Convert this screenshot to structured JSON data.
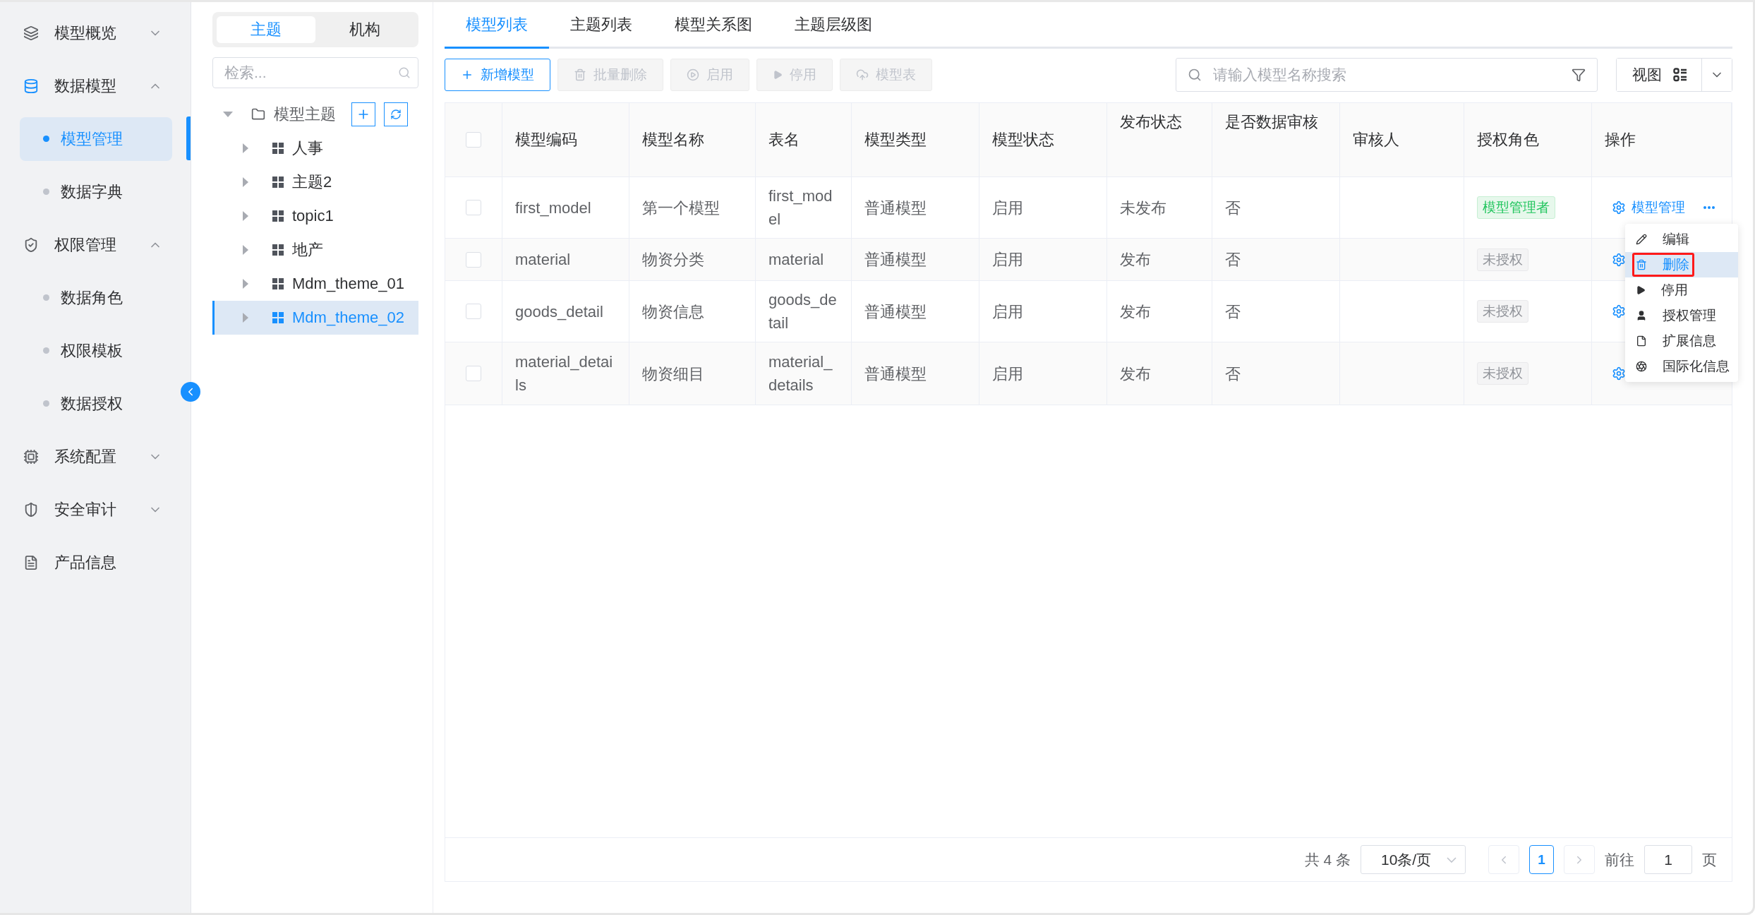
{
  "sidebar": {
    "groups": [
      {
        "label": "模型概览",
        "expanded": false
      },
      {
        "label": "数据模型",
        "expanded": true,
        "active": true,
        "items": [
          {
            "label": "模型管理",
            "selected": true
          },
          {
            "label": "数据字典",
            "selected": false
          }
        ]
      },
      {
        "label": "权限管理",
        "expanded": true,
        "active": false,
        "items": [
          {
            "label": "数据角色",
            "selected": false
          },
          {
            "label": "权限模板",
            "selected": false
          },
          {
            "label": "数据授权",
            "selected": false
          }
        ]
      },
      {
        "label": "系统配置",
        "expanded": false
      },
      {
        "label": "安全审计",
        "expanded": false
      },
      {
        "label": "产品信息",
        "kind": "link"
      }
    ]
  },
  "tree_panel": {
    "segments": [
      {
        "label": "主题",
        "selected": true
      },
      {
        "label": "机构",
        "selected": false
      }
    ],
    "search": {
      "placeholder": "检索..."
    },
    "root": {
      "label": "模型主题",
      "expanded": true,
      "children": [
        {
          "label": "人事",
          "selected": false
        },
        {
          "label": "主题2",
          "selected": false
        },
        {
          "label": "topic1",
          "selected": false
        },
        {
          "label": "地产",
          "selected": false
        },
        {
          "label": "Mdm_theme_01",
          "selected": false
        },
        {
          "label": "Mdm_theme_02",
          "selected": true
        }
      ]
    }
  },
  "tabs": [
    {
      "label": "模型列表",
      "selected": true
    },
    {
      "label": "主题列表",
      "selected": false
    },
    {
      "label": "模型关系图",
      "selected": false
    },
    {
      "label": "主题层级图",
      "selected": false
    }
  ],
  "toolbar": {
    "buttons": [
      {
        "label": "新增模型",
        "disabled": false
      },
      {
        "label": "批量删除",
        "disabled": true
      },
      {
        "label": "启用",
        "disabled": true
      },
      {
        "label": "停用",
        "disabled": true
      },
      {
        "label": "模型表",
        "disabled": true
      }
    ],
    "search": {
      "placeholder": "请输入模型名称搜索"
    },
    "view_button": "视图"
  },
  "table": {
    "header_checked": false,
    "columns": [
      "模型编码",
      "模型名称",
      "表名",
      "模型类型",
      "模型状态",
      "发布状态",
      "是否数据审核",
      "审核人",
      "授权角色",
      "操作"
    ],
    "rows": [
      {
        "checked": false,
        "cells": [
          "first_model",
          "第一个模型",
          "first_model",
          "普通模型",
          "启用",
          "未发布",
          "否"
        ],
        "role": {
          "label": "模型管理者",
          "kind": "granted"
        },
        "action": "模型管理"
      },
      {
        "checked": false,
        "cells": [
          "material",
          "物资分类",
          "material",
          "普通模型",
          "启用",
          "发布",
          "否"
        ],
        "role": {
          "label": "未授权",
          "kind": "none"
        }
      },
      {
        "checked": false,
        "cells": [
          "goods_detail",
          "物资信息",
          "goods_detail",
          "普通模型",
          "启用",
          "发布",
          "否"
        ],
        "role": {
          "label": "未授权",
          "kind": "none"
        }
      },
      {
        "checked": false,
        "cells": [
          "material_details",
          "物资细目",
          "material_details",
          "普通模型",
          "启用",
          "发布",
          "否"
        ],
        "role": {
          "label": "未授权",
          "kind": "none"
        }
      }
    ]
  },
  "action_menu": [
    {
      "label": "编辑",
      "selected": false,
      "marked": false
    },
    {
      "label": "删除",
      "selected": true,
      "marked": true
    },
    {
      "label": "停用",
      "selected": false,
      "marked": false
    },
    {
      "label": "授权管理",
      "selected": false,
      "marked": false
    },
    {
      "label": "扩展信息",
      "selected": false,
      "marked": false
    },
    {
      "label": "国际化信息",
      "selected": false,
      "marked": false
    }
  ],
  "pagination": {
    "total": "共 4 条",
    "page_size": "10条/页",
    "pages": [
      {
        "label": "1",
        "selected": true
      }
    ],
    "goto_label": "前往",
    "goto_value": "1",
    "page_suffix": "页"
  }
}
